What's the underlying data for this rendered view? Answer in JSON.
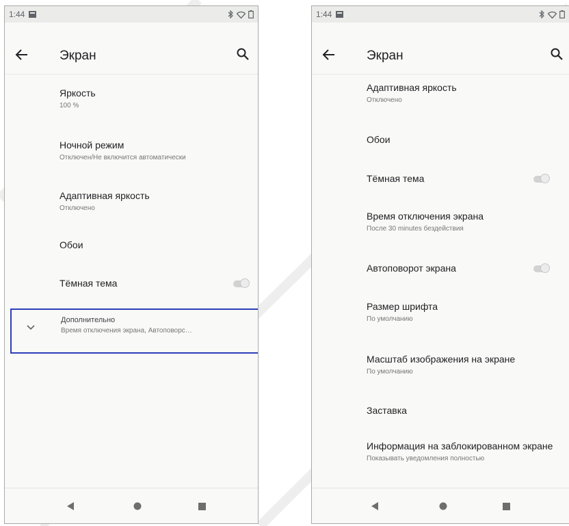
{
  "status_bar": {
    "time": "1:44"
  },
  "left_screen": {
    "title": "Экран",
    "items": [
      {
        "title": "Яркость",
        "summary": "100 %"
      },
      {
        "title": "Ночной режим",
        "summary": "Отключен/Не включится автоматически"
      },
      {
        "title": "Адаптивная яркость",
        "summary": "Отключено"
      },
      {
        "title": "Обои",
        "summary": ""
      },
      {
        "title": "Тёмная тема",
        "summary": "",
        "toggle": false
      }
    ],
    "advanced": {
      "title": "Дополнительно",
      "summary": "Время отключения экрана, Автоповорс…"
    }
  },
  "right_screen": {
    "title": "Экран",
    "items": [
      {
        "title": "Адаптивная яркость",
        "summary": "Отключено"
      },
      {
        "title": "Обои",
        "summary": ""
      },
      {
        "title": "Тёмная тема",
        "summary": "",
        "toggle": false
      },
      {
        "title": "Время отключения экрана",
        "summary": "После 30 minutes бездействия"
      },
      {
        "title": "Автоповорот экрана",
        "summary": "",
        "toggle": false
      },
      {
        "title": "Размер шрифта",
        "summary": "По умолчанию"
      },
      {
        "title": "Масштаб изображения на экране",
        "summary": "По умолчанию"
      },
      {
        "title": "Заставка",
        "summary": ""
      },
      {
        "title": "Информация на заблокированном экране",
        "summary": "Показывать уведомления полностью"
      }
    ]
  },
  "icons": {
    "back": "arrow-back-icon",
    "search": "search-icon",
    "expand": "chevron-down-icon",
    "nav_back": "triangle-back-icon",
    "nav_home": "circle-home-icon",
    "nav_recents": "square-recents-icon",
    "status": [
      "notification-icon",
      "bluetooth-icon",
      "wifi-icon",
      "battery-icon"
    ]
  },
  "colors": {
    "highlight_border": "#2f3eb8",
    "background": "#f9f9f7",
    "status_bar": "#ebebe9",
    "primary_text": "#202124",
    "secondary_text": "#767676"
  }
}
